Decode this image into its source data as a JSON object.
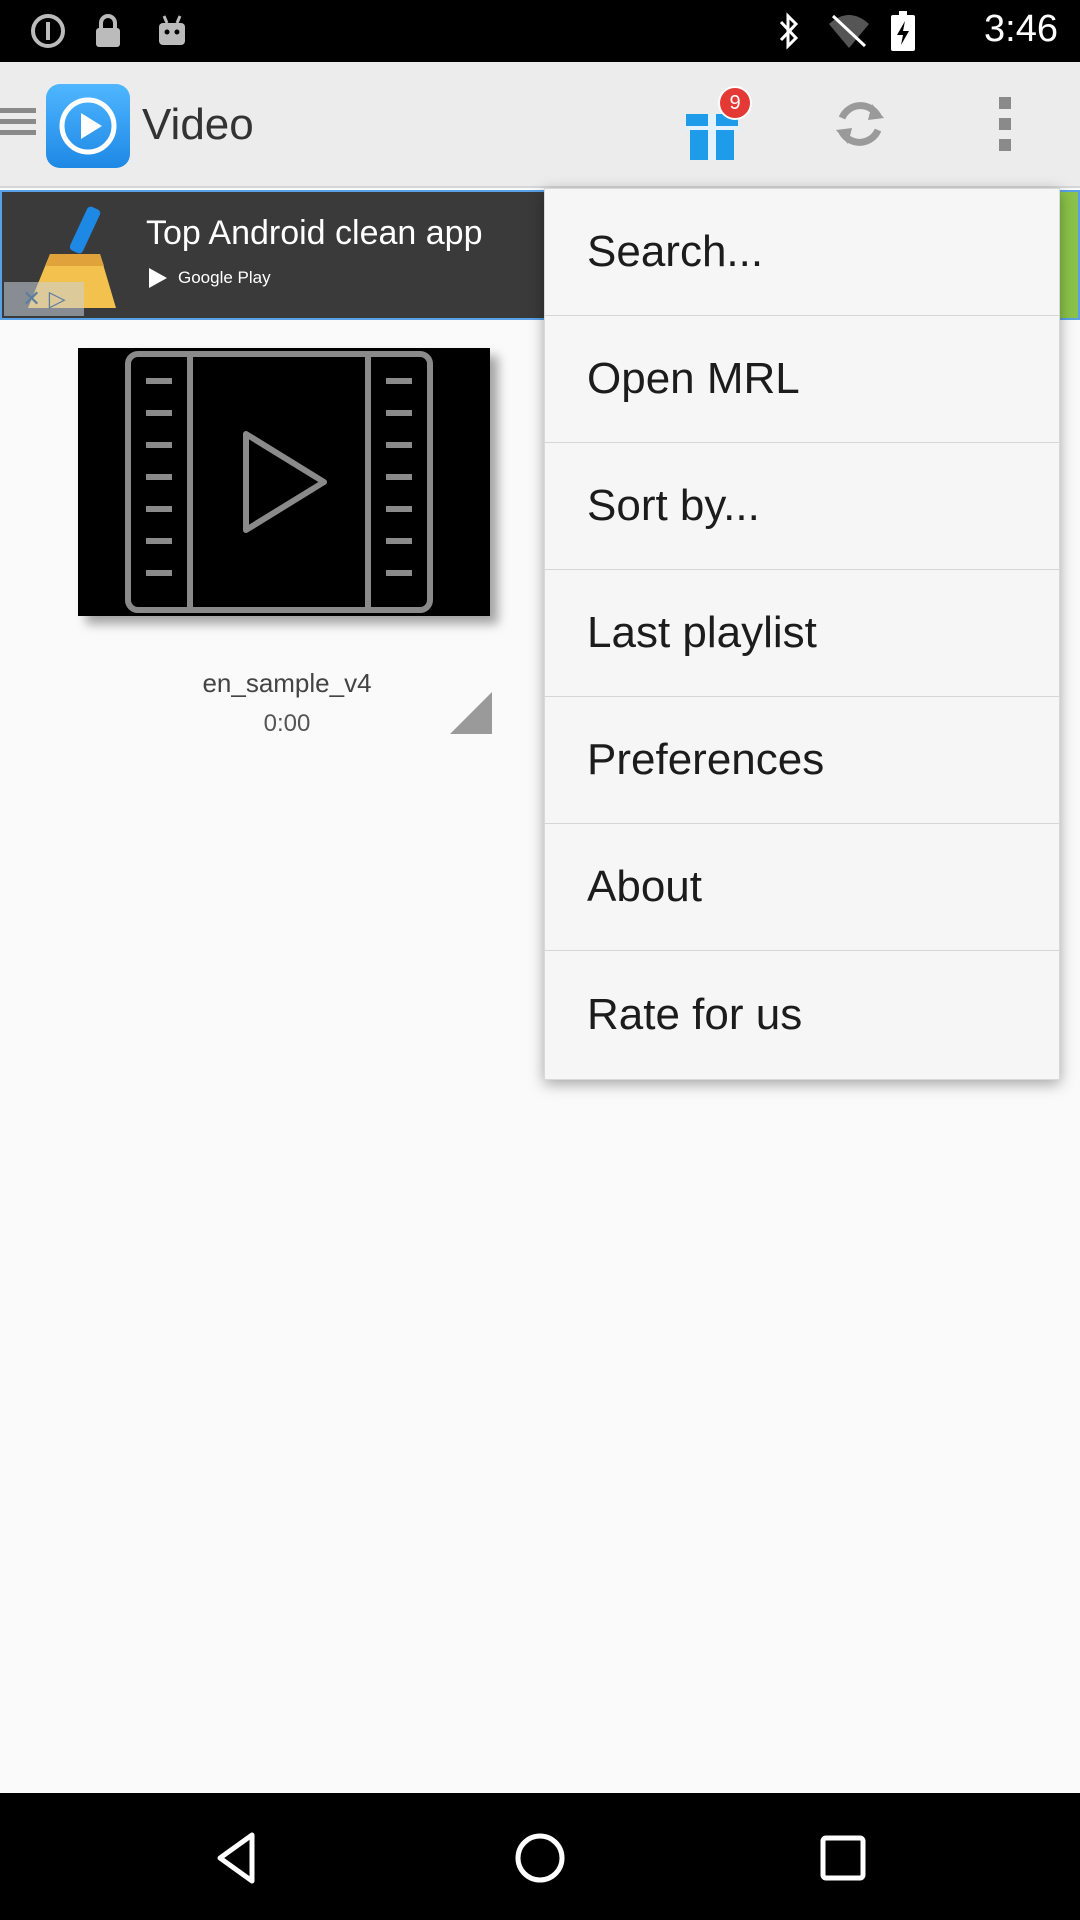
{
  "status_bar": {
    "time": "3:46",
    "icons": [
      "alert-circle-icon",
      "lock-icon",
      "android-icon",
      "bluetooth-icon",
      "wifi-off-icon",
      "battery-charging-icon"
    ]
  },
  "app_bar": {
    "title": "Video",
    "gift_badge_count": "9",
    "icons": [
      "menu-icon",
      "app-logo-icon",
      "gift-icon",
      "refresh-icon",
      "overflow-menu-icon"
    ]
  },
  "ad": {
    "title": "Top Android clean app",
    "store_label": "Google Play",
    "accent_color": "#8bc34a"
  },
  "video_list": [
    {
      "name": "en_sample_v4",
      "duration": "0:00"
    }
  ],
  "menu": {
    "items": [
      "Search...",
      "Open MRL",
      "Sort by...",
      "Last playlist",
      "Preferences",
      "About",
      "Rate for us"
    ]
  },
  "nav_bar": {
    "icons": [
      "back-icon",
      "home-icon",
      "recents-icon"
    ]
  },
  "colors": {
    "accent": "#1e88e5",
    "badge": "#e53935",
    "background": "#fafafa"
  }
}
